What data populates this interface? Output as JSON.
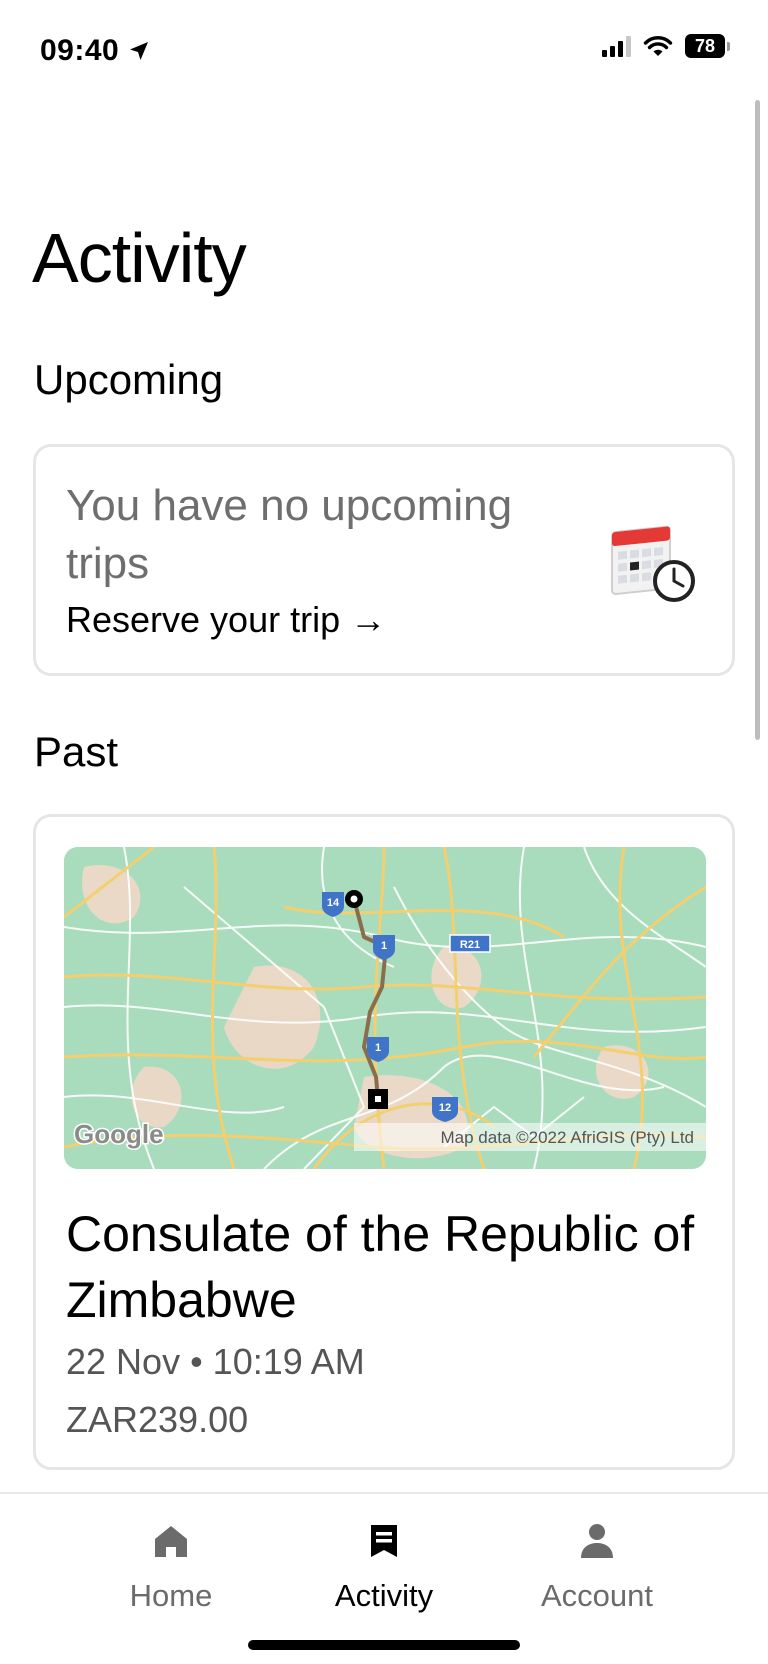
{
  "status_bar": {
    "time": "09:40",
    "battery": "78"
  },
  "page": {
    "title": "Activity"
  },
  "upcoming": {
    "heading": "Upcoming",
    "empty_message": "You have no upcoming trips",
    "reserve_label": "Reserve your trip",
    "reserve_arrow": "→"
  },
  "past": {
    "heading": "Past",
    "trips": [
      {
        "destination": "Consulate of the Republic of Zimbabwe",
        "date_time": "22 Nov • 10:19 AM",
        "price": "ZAR239.00",
        "map": {
          "logo": "Google",
          "attribution": "Map data ©2022 AfriGIS (Pty) Ltd",
          "route_shields": [
            "14",
            "1",
            "1",
            "12",
            "R21"
          ]
        }
      }
    ]
  },
  "nav": {
    "home_label": "Home",
    "activity_label": "Activity",
    "account_label": "Account",
    "active": "Activity"
  },
  "colors": {
    "map_green": "#a9dcbc",
    "map_road": "#f5d27a",
    "route": "#8a6e4b",
    "shield_blue": "#3f74c9",
    "muted_text": "#6b6b6b"
  },
  "icons": [
    "location-arrow-icon",
    "signal-icon",
    "wifi-icon",
    "battery-icon",
    "calendar-clock-icon",
    "home-icon",
    "activity-icon",
    "account-icon"
  ]
}
